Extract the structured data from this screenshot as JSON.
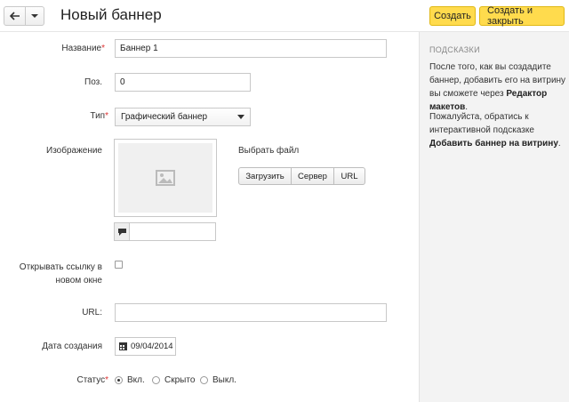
{
  "header": {
    "title": "Новый баннер",
    "create_label": "Создать",
    "create_close_label": "Создать и закрыть"
  },
  "form": {
    "name": {
      "label": "Название",
      "required": "*",
      "value": "Баннер 1"
    },
    "position": {
      "label": "Поз.",
      "value": "0"
    },
    "type": {
      "label": "Тип",
      "required": "*",
      "value": "Графический баннер"
    },
    "image": {
      "label": "Изображение",
      "choose_file": "Выбрать файл",
      "upload_label": "Загрузить",
      "server_label": "Сервер",
      "url_label": "URL"
    },
    "open_link": {
      "label_line1": "Открывать ссылку в",
      "label_line2": "новом окне"
    },
    "url": {
      "label": "URL:",
      "value": ""
    },
    "created": {
      "label": "Дата создания",
      "value": "09/04/2014"
    },
    "status": {
      "label": "Статус",
      "required": "*",
      "options": [
        "Вкл.",
        "Скрыто",
        "Выкл."
      ],
      "selected": "Вкл."
    }
  },
  "sidebar": {
    "title": "ПОДСКАЗКИ",
    "hint1_text": "После того, как вы создадите баннер, добавить его на витрину вы сможете через ",
    "hint1_bold": "Редактор макетов",
    "hint1_end": ".",
    "hint2_text": "Пожалуйста, обратись к интерактивной подсказке ",
    "hint2_bold": "Добавить баннер на витрину",
    "hint2_end": "."
  },
  "colors": {
    "accent_button": "#ffdb4d",
    "sidebar_bg": "#f3f3f3",
    "required_mark": "#dd3333"
  }
}
